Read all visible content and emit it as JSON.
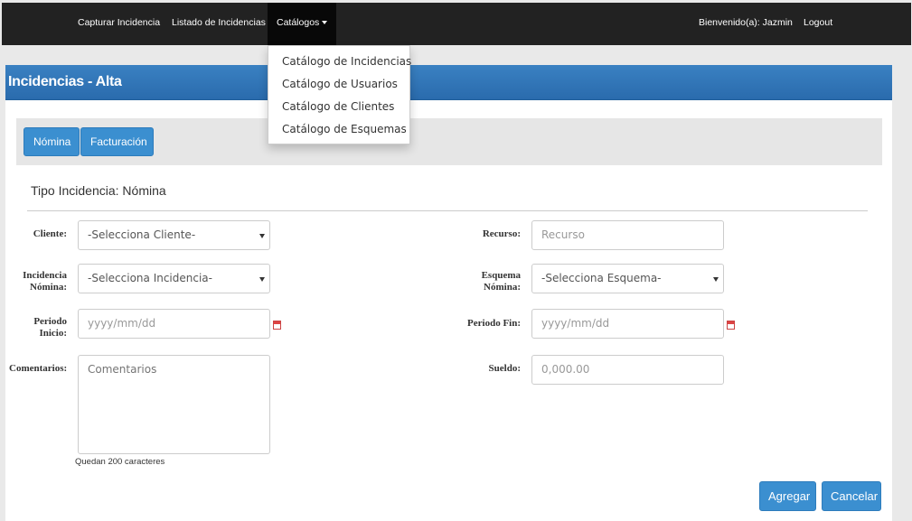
{
  "navbar": {
    "items": [
      {
        "label": "Capturar Incidencia"
      },
      {
        "label": "Listado de Incidencias"
      },
      {
        "label": "Catálogos"
      }
    ],
    "welcome": "Bienvenido(a): Jazmin",
    "logout": "Logout"
  },
  "dropdown": {
    "items": [
      "Catálogo de Incidencias",
      "Catálogo de Usuarios",
      "Catálogo de Clientes",
      "Catálogo de Esquemas"
    ]
  },
  "panel": {
    "title": "Incidencias - Alta",
    "tabs": [
      "Nómina",
      "Facturación"
    ],
    "section_title": "Tipo Incidencia: Nómina"
  },
  "form": {
    "cliente": {
      "label": "Cliente:",
      "value": "-Selecciona Cliente-"
    },
    "incidencia": {
      "label_1": "Incidencia",
      "label_2": "Nómina:",
      "value": "-Selecciona Incidencia-"
    },
    "periodo_inicio": {
      "label_1": "Periodo",
      "label_2": "Inicio:",
      "placeholder": "yyyy/mm/dd"
    },
    "comentarios": {
      "label": "Comentarios:",
      "placeholder": "Comentarios",
      "helper": "Quedan 200 caracteres"
    },
    "recurso": {
      "label": "Recurso:",
      "placeholder": "Recurso"
    },
    "esquema": {
      "label_1": "Esquema",
      "label_2": "Nómina:",
      "value": "-Selecciona Esquema-"
    },
    "periodo_fin": {
      "label": "Periodo Fin:",
      "placeholder": "yyyy/mm/dd"
    },
    "sueldo": {
      "label": "Sueldo:",
      "placeholder": "0,000.00"
    }
  },
  "actions": {
    "add": "Agregar",
    "cancel": "Cancelar"
  },
  "colors": {
    "navbar": "#222222",
    "primary": "#3b8fd0",
    "panel_header": "#2f73b5"
  }
}
